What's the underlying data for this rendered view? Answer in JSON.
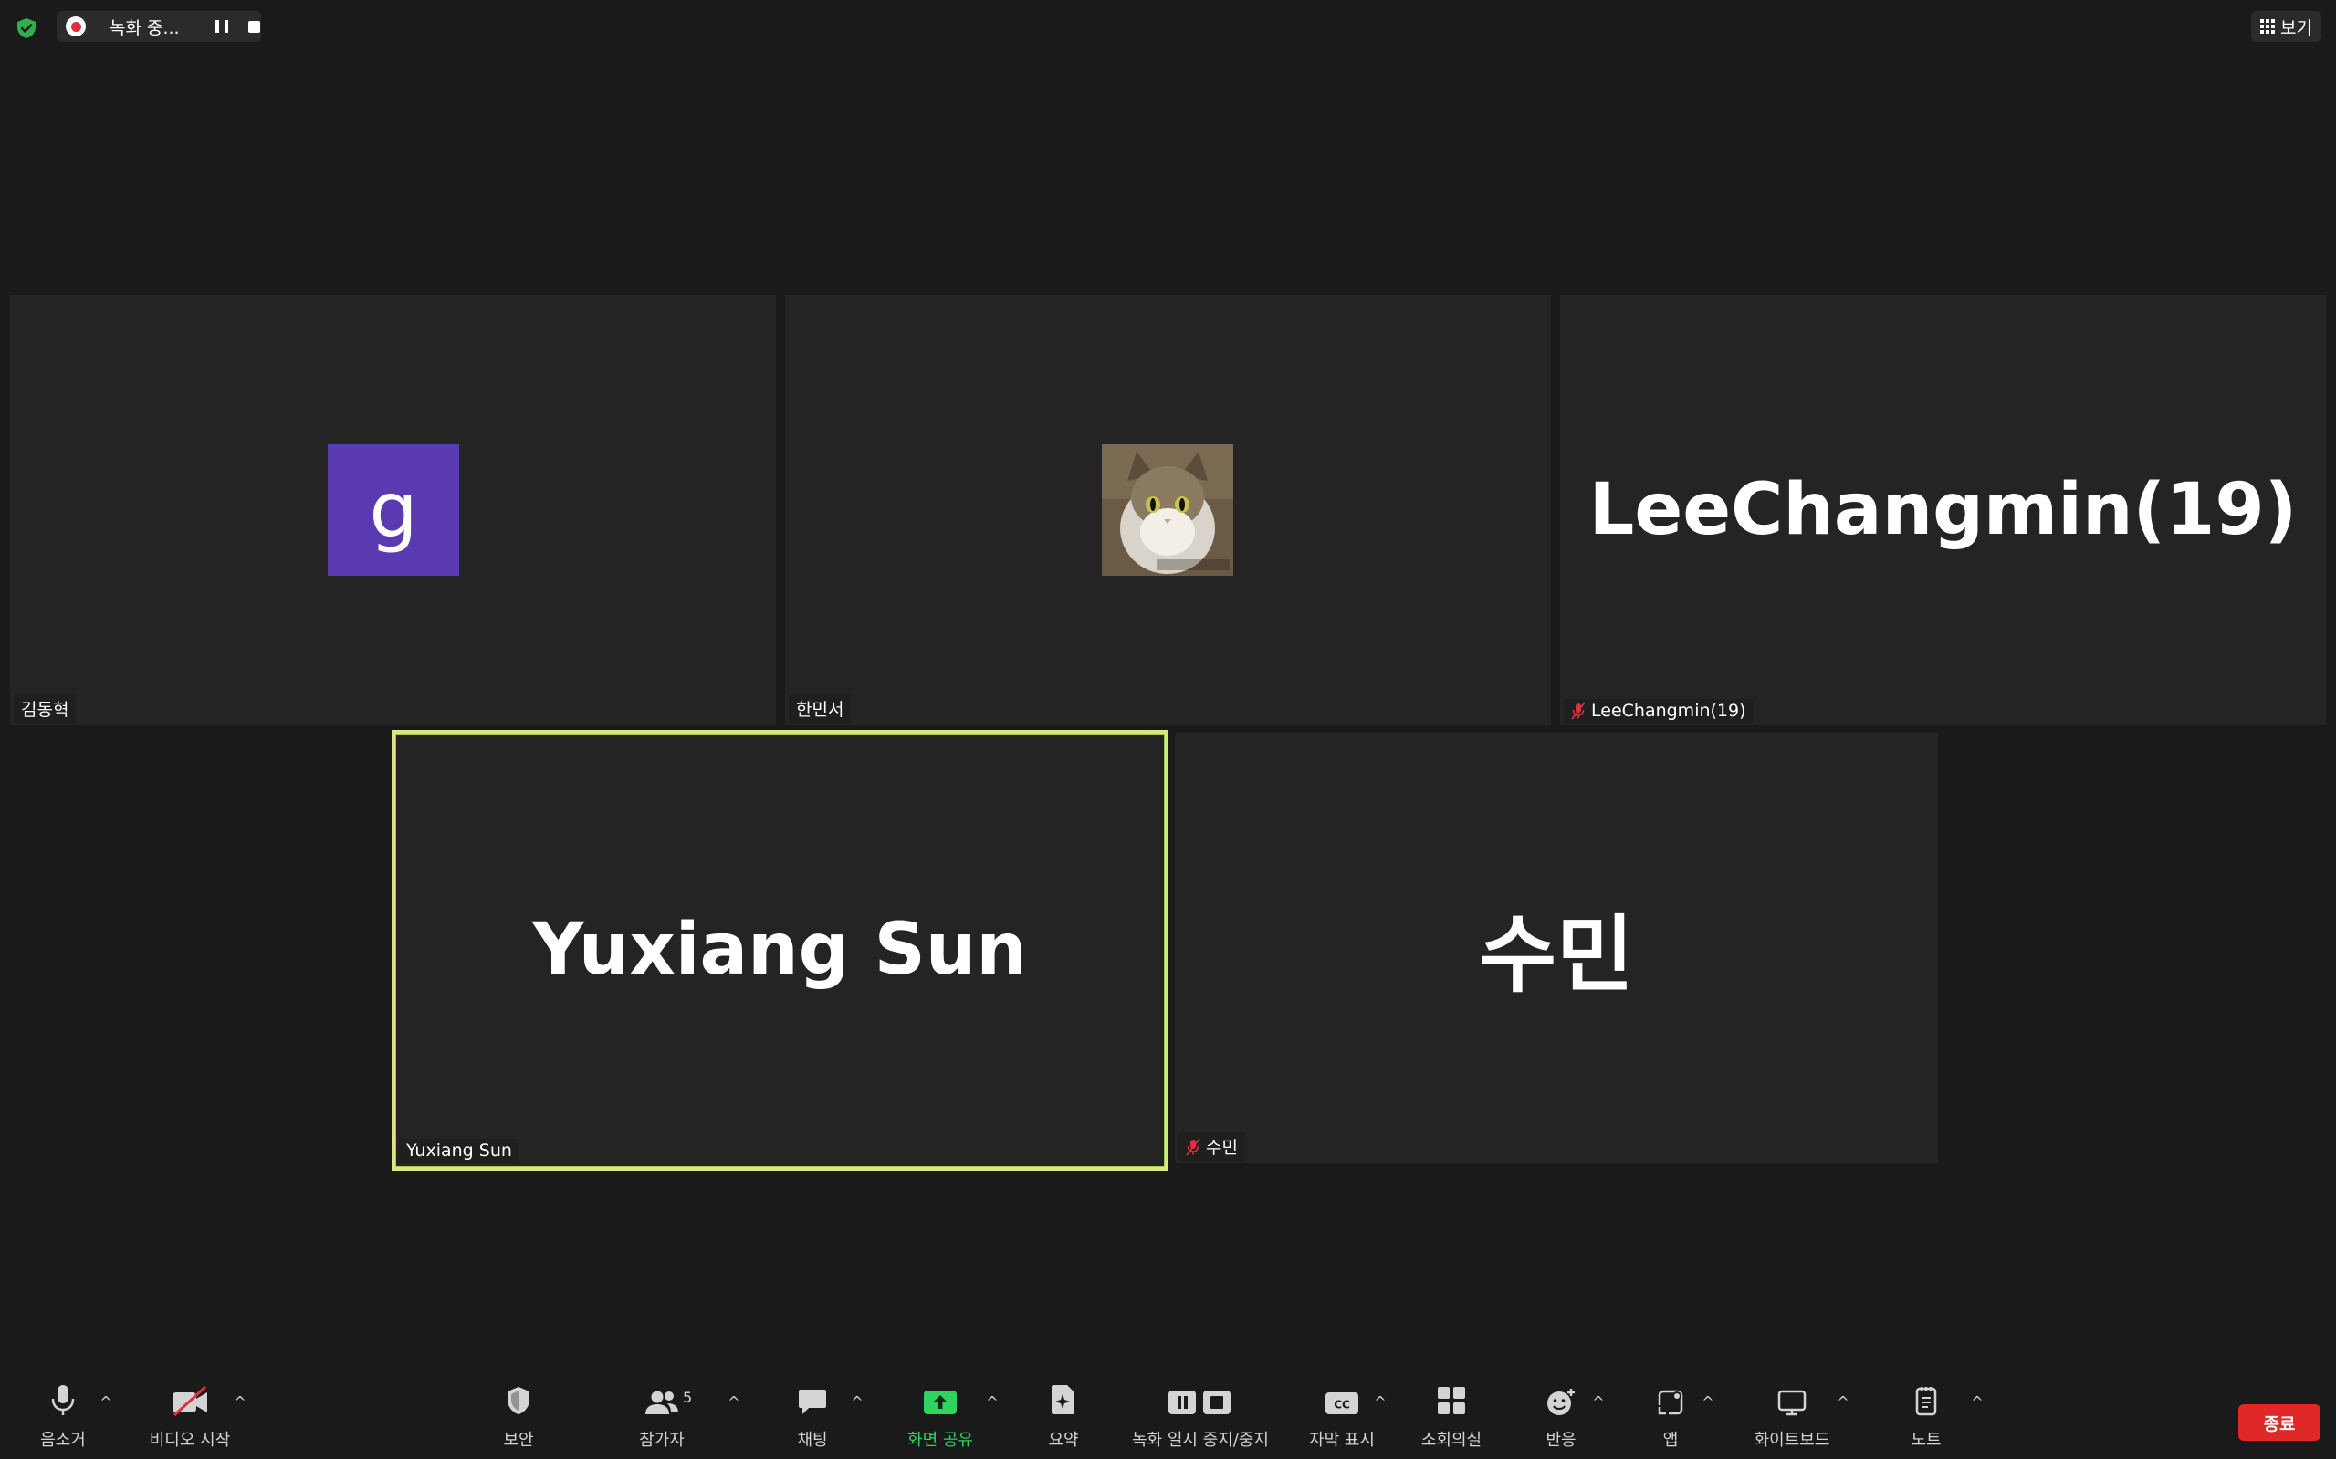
{
  "top_bar": {
    "recording_status": "녹화 중...",
    "view_label": "보기"
  },
  "tiles": [
    {
      "name": "김동혁",
      "avatar_letter": "g",
      "avatar_color": "#5a3ab0",
      "muted": false
    },
    {
      "name": "한민서",
      "avatar": "cat-photo",
      "muted": false
    },
    {
      "name": "LeeChangmin(19)",
      "display_name": "LeeChangmin(19)",
      "muted": true
    },
    {
      "name": "Yuxiang Sun",
      "display_name": "Yuxiang Sun",
      "muted": false,
      "active_speaker": true
    },
    {
      "name": "수민",
      "display_name": "수민",
      "muted": true
    }
  ],
  "toolbar": {
    "mute_label": "음소거",
    "video_label": "비디오 시작",
    "security_label": "보안",
    "participants_label": "참가자",
    "participants_count": "5",
    "chat_label": "채팅",
    "share_label": "화면 공유",
    "summary_label": "요약",
    "record_label": "녹화 일시 중지/중지",
    "captions_label": "자막 표시",
    "breakout_label": "소회의실",
    "reactions_label": "반응",
    "apps_label": "앱",
    "whiteboard_label": "화이트보드",
    "notes_label": "노트",
    "end_label": "종료"
  },
  "colors": {
    "background": "#1a1a1a",
    "tile": "#242424",
    "active_speaker_border": "#d9e886",
    "share_green": "#2fd35f",
    "end_red": "#e02828",
    "security_green": "#2fb24c"
  }
}
